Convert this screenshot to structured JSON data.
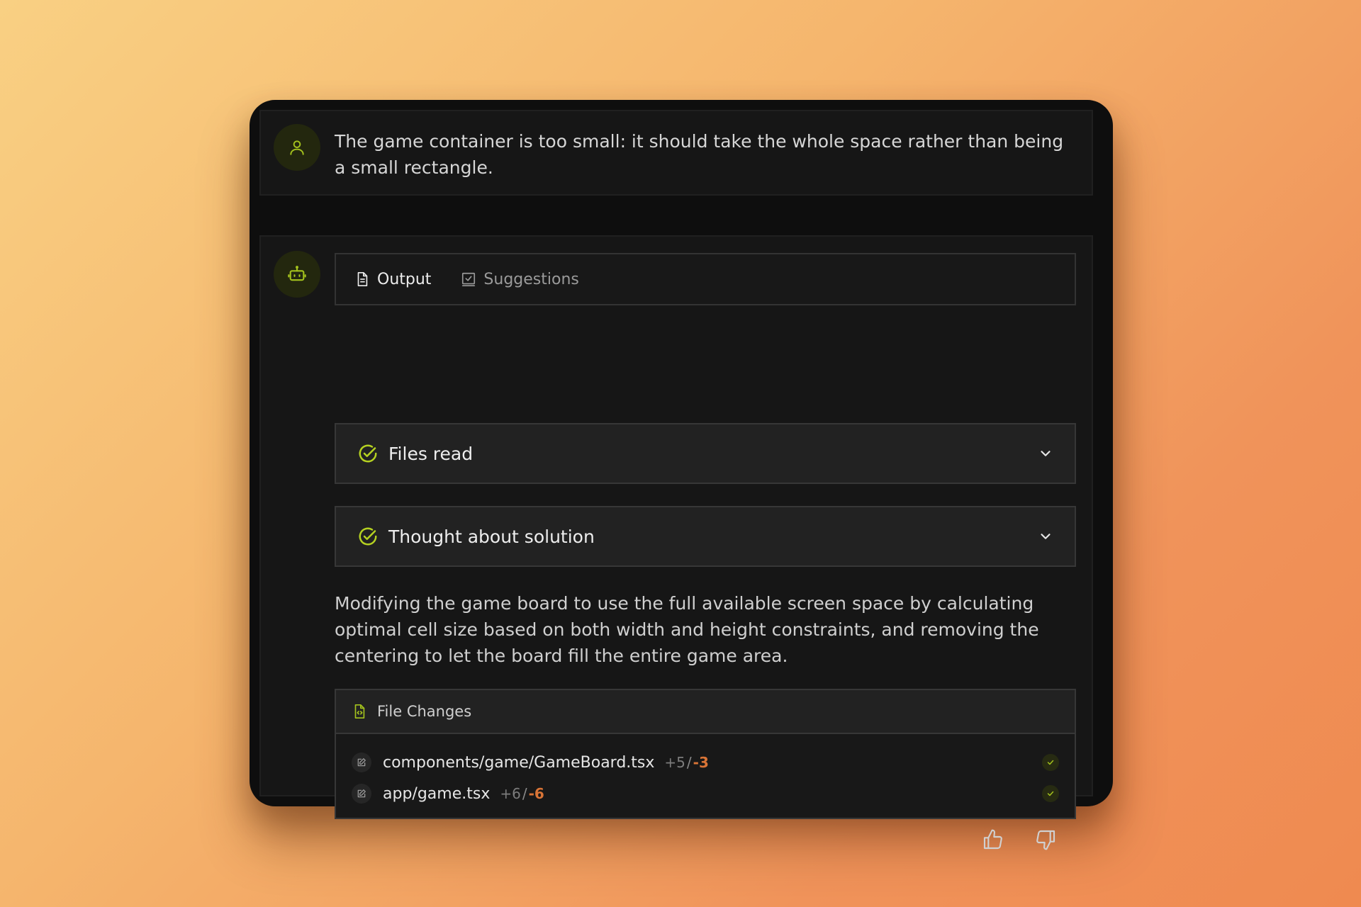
{
  "user_message": {
    "avatar_icon": "user-icon",
    "text": "The game container is too small: it should take the whole space rather than being a small rectangle."
  },
  "assistant": {
    "avatar_icon": "robot-icon",
    "tabs": [
      {
        "label": "Output",
        "icon": "document-icon",
        "active": true
      },
      {
        "label": "Suggestions",
        "icon": "suggestion-icon",
        "active": false
      }
    ],
    "steps": [
      {
        "label": "Files read",
        "icon": "check-circle-icon",
        "state": "collapsed"
      },
      {
        "label": "Thought about solution",
        "icon": "check-circle-icon",
        "state": "collapsed"
      }
    ],
    "description": "Modifying the game board to use the full available screen space by calculating optimal cell size based on both width and height constraints, and removing the centering to let the board fill the entire game area.",
    "file_changes": {
      "title": "File Changes",
      "files": [
        {
          "path": "components/game/GameBoard.tsx",
          "added": "+5",
          "removed": "-3",
          "status": "applied"
        },
        {
          "path": "app/game.tsx",
          "added": "+6",
          "removed": "-6",
          "status": "applied"
        }
      ]
    },
    "feedback": [
      "thumbs-up-icon",
      "thumbs-down-icon"
    ]
  },
  "colors": {
    "accent": "#b5d121",
    "removed": "#d97436",
    "panel": "#161616",
    "window": "#0e0e0e"
  }
}
